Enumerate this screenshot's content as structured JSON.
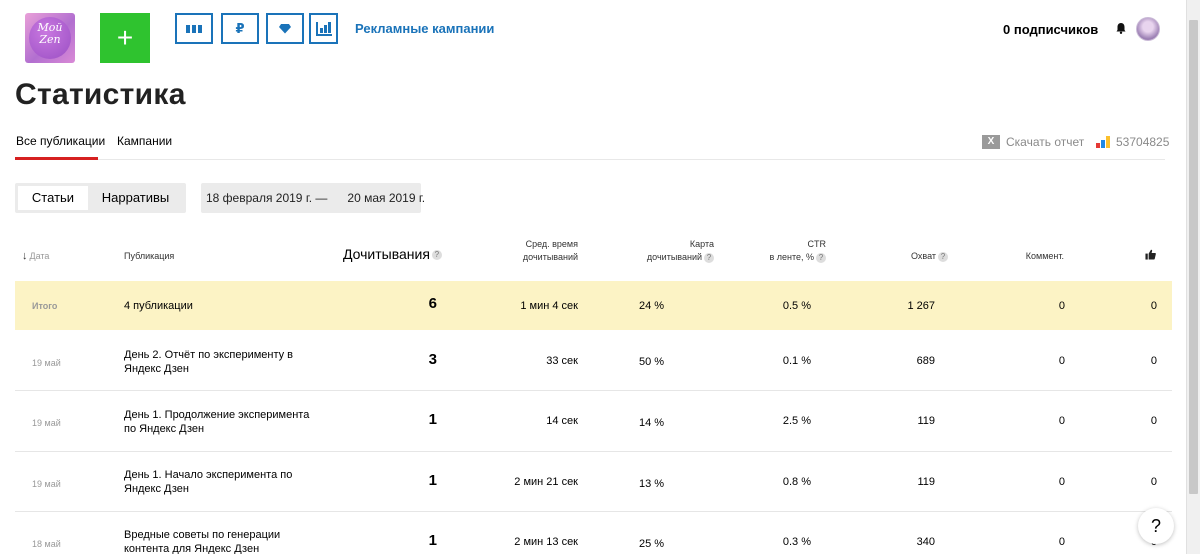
{
  "header": {
    "logo_text_line1": "Мой",
    "logo_text_line2": "Zen",
    "add_label": "+",
    "tool_rub_label": "₽",
    "ad_campaigns_link": "Рекламные кампании",
    "subscribers": "0 подписчиков",
    "icons": [
      "add-icon",
      "bars-icon",
      "ruble-icon",
      "diamond-icon",
      "chart-icon",
      "bell-icon",
      "avatar"
    ]
  },
  "page": {
    "title": "Статистика",
    "tabs": [
      {
        "label": "Все публикации",
        "active": true
      },
      {
        "label": "Кампании",
        "active": false
      }
    ],
    "download_label": "Скачать отчет",
    "xls_icon_label": "X",
    "counter_id": "53704825"
  },
  "filters": {
    "segment": [
      {
        "label": "Статьи",
        "active": true
      },
      {
        "label": "Нарративы",
        "active": false
      }
    ],
    "date_range": "18 февраля 2019 г. —      20 мая 2019 г."
  },
  "table": {
    "headers": {
      "date": "Дата",
      "publication": "Публикация",
      "reads": "Дочитывания",
      "avg_time_line1": "Сред. время",
      "avg_time_line2": "дочитываний",
      "card_line1": "Карта",
      "card_line2": "дочитываний",
      "ctr_line1": "CTR",
      "ctr_line2": "в ленте, %",
      "reach": "Охват",
      "comments": "Коммент.",
      "help_mark": "?"
    },
    "total": {
      "label": "Итого",
      "publication": "4 публикации",
      "reads": "6",
      "avg_time": "1 мин 4 сек",
      "card": "24 %",
      "ctr": "0.5 %",
      "reach": "1 267",
      "comments": "0",
      "likes": "0"
    },
    "rows": [
      {
        "date": "19 май",
        "publication": "День 2. Отчёт по эксперименту в Яндекс Дзен",
        "reads": "3",
        "avg_time": "33 сек",
        "card": "50 %",
        "ctr": "0.1 %",
        "reach": "689",
        "comments": "0",
        "likes": "0"
      },
      {
        "date": "19 май",
        "publication": "День 1. Продолжение эксперимента по Яндекс Дзен",
        "reads": "1",
        "avg_time": "14 сек",
        "card": "14 %",
        "ctr": "2.5 %",
        "reach": "119",
        "comments": "0",
        "likes": "0"
      },
      {
        "date": "19 май",
        "publication": "День 1. Начало эксперимента по Яндекс Дзен",
        "reads": "1",
        "avg_time": "2 мин 21 сек",
        "card": "13 %",
        "ctr": "0.8 %",
        "reach": "119",
        "comments": "0",
        "likes": "0"
      },
      {
        "date": "18 май",
        "publication": "Вредные советы по генерации контента для Яндекс Дзен",
        "reads": "1",
        "avg_time": "2 мин 13 сек",
        "card": "25 %",
        "ctr": "0.3 %",
        "reach": "340",
        "comments": "0",
        "likes": "0"
      }
    ]
  },
  "help_button_label": "?",
  "colors": {
    "accent_blue": "#1a73b9",
    "add_green": "#2fc32f",
    "tab_red": "#d62020",
    "total_row_bg": "#fcf3c5"
  }
}
